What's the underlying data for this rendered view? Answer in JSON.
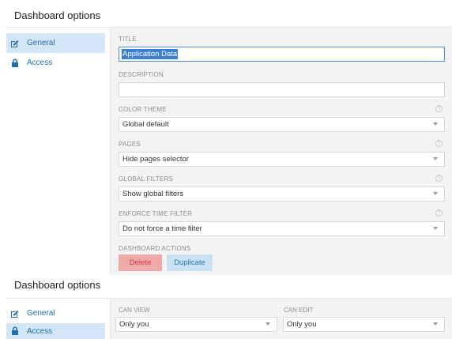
{
  "top": {
    "title": "Dashboard options",
    "sidebar": [
      {
        "label": "General",
        "icon": "edit-icon"
      },
      {
        "label": "Access",
        "icon": "lock-icon"
      }
    ],
    "fields": {
      "title": {
        "label": "TITLE",
        "value": "Application Data"
      },
      "description": {
        "label": "DESCRIPTION",
        "value": ""
      },
      "color_theme": {
        "label": "COLOR THEME",
        "value": "Global default"
      },
      "pages": {
        "label": "PAGES",
        "value": "Hide pages selector"
      },
      "global_filters": {
        "label": "GLOBAL FILTERS",
        "value": "Show global filters"
      },
      "enforce_time_filter": {
        "label": "ENFORCE TIME FILTER",
        "value": "Do not force a time filter"
      },
      "dashboard_actions": {
        "label": "DASHBOARD ACTIONS"
      }
    },
    "actions": {
      "delete": "Delete",
      "duplicate": "Duplicate"
    }
  },
  "bottom": {
    "title": "Dashboard options",
    "sidebar": [
      {
        "label": "General",
        "icon": "edit-icon"
      },
      {
        "label": "Access",
        "icon": "lock-icon"
      }
    ],
    "can_view": {
      "label": "CAN VIEW",
      "value": "Only you"
    },
    "can_edit": {
      "label": "CAN EDIT",
      "value": "Only you"
    }
  },
  "colors": {
    "accent": "#1f6fb0",
    "active_bg": "#d4e5f6",
    "danger": "#f0a9a9",
    "secondary": "#c8e1f3"
  }
}
